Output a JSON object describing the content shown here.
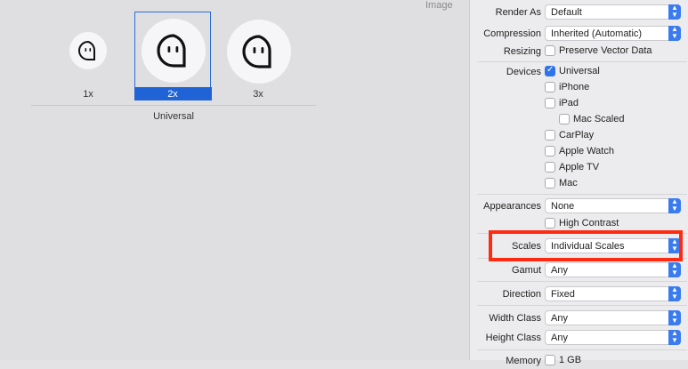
{
  "canvas": {
    "section_header": "Image",
    "scales": [
      "1x",
      "2x",
      "3x"
    ],
    "selected_scale": "2x",
    "group_caption": "Universal"
  },
  "inspector": {
    "render_as": {
      "label": "Render As",
      "value": "Default"
    },
    "compression": {
      "label": "Compression",
      "value": "Inherited (Automatic)"
    },
    "resizing": {
      "label": "Resizing",
      "option": "Preserve Vector Data",
      "checked": false
    },
    "devices": {
      "label": "Devices",
      "items": [
        {
          "name": "Universal",
          "checked": true
        },
        {
          "name": "iPhone",
          "checked": false
        },
        {
          "name": "iPad",
          "checked": false
        },
        {
          "name": "Mac Scaled",
          "checked": false
        },
        {
          "name": "CarPlay",
          "checked": false
        },
        {
          "name": "Apple Watch",
          "checked": false
        },
        {
          "name": "Apple TV",
          "checked": false
        },
        {
          "name": "Mac",
          "checked": false
        }
      ]
    },
    "appearances": {
      "label": "Appearances",
      "value": "None",
      "option": "High Contrast"
    },
    "scales": {
      "label": "Scales",
      "value": "Individual Scales"
    },
    "gamut": {
      "label": "Gamut",
      "value": "Any"
    },
    "direction": {
      "label": "Direction",
      "value": "Fixed"
    },
    "width_class": {
      "label": "Width Class",
      "value": "Any"
    },
    "height_class": {
      "label": "Height Class",
      "value": "Any"
    },
    "memory": {
      "label": "Memory",
      "option": "1 GB"
    }
  },
  "colors": {
    "selection": "#1f63d6",
    "highlight": "#ff2a12",
    "popup_arrows": "#3a7bf0"
  },
  "icons": {
    "slot_image": "speech-bubble-face-icon",
    "popup": "up-down-chevron-icon",
    "checked": "checkmark-icon"
  }
}
